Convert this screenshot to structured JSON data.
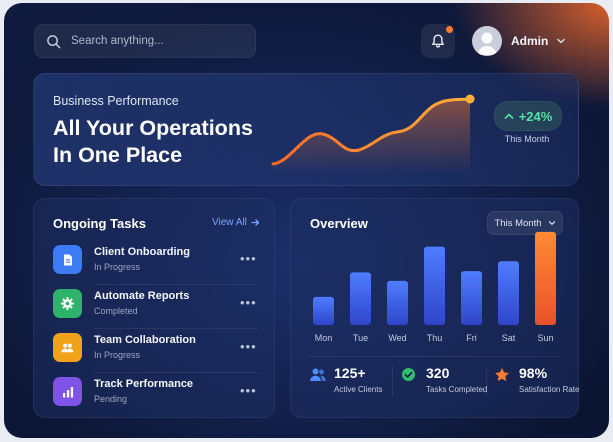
{
  "header": {
    "search_placeholder": "Search anything...",
    "user_name": "Admin",
    "notification_dot": true
  },
  "hero": {
    "kicker": "Business Performance",
    "title_line1": "All Your Operations",
    "title_line2": "In One Place",
    "growth_value": "+24%",
    "growth_period": "This Month"
  },
  "tasks": {
    "title": "Ongoing Tasks",
    "view_all": "View All",
    "items": [
      {
        "name": "Client Onboarding",
        "status": "In Progress",
        "icon": "document-icon",
        "color": "#3d7bf5"
      },
      {
        "name": "Automate Reports",
        "status": "Completed",
        "icon": "gear-icon",
        "color": "#2fb36a"
      },
      {
        "name": "Team Collaboration",
        "status": "In Progress",
        "icon": "team-icon",
        "color": "#f0a21a"
      },
      {
        "name": "Track Performance",
        "status": "Pending",
        "icon": "bar-chart-icon",
        "color": "#7f53e8"
      }
    ],
    "more_glyph": "•••"
  },
  "overview": {
    "title": "Overview",
    "period_select": "This Month",
    "chart_data": {
      "type": "bar",
      "categories": [
        "Mon",
        "Tue",
        "Wed",
        "Thu",
        "Fri",
        "Sat",
        "Sun"
      ],
      "values": [
        23,
        43,
        36,
        64,
        44,
        52,
        76
      ],
      "highlight": "Sun",
      "colors": {
        "default": "#3f5fe6",
        "highlight": "#ff7a2f"
      }
    },
    "stats": [
      {
        "value": "125+",
        "label": "Active Clients",
        "icon": "users-icon",
        "color": "#4d8dff"
      },
      {
        "value": "320",
        "label": "Tasks Completed",
        "icon": "check-circle-icon",
        "color": "#2fbf71"
      },
      {
        "value": "98%",
        "label": "Satisfaction Rate",
        "icon": "star-icon",
        "color": "#ff7a2f"
      }
    ]
  },
  "colors": {
    "accent_orange": "#ff7a2f",
    "accent_green": "#56e3a7",
    "link_blue": "#7fa4ff",
    "background": "#0d1838"
  }
}
